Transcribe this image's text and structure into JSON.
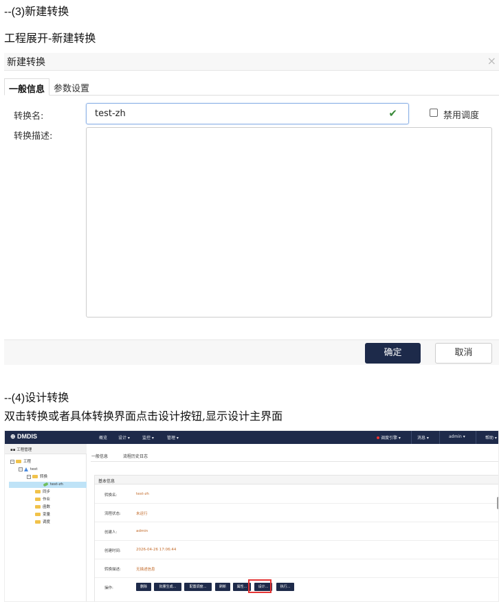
{
  "step3": {
    "num": "--(3)",
    "title": "新建转换"
  },
  "step3_sub": "工程展开-新建转换",
  "dialog": {
    "title": "新建转换",
    "close": "×",
    "tabs": [
      {
        "label": "一般信息"
      },
      {
        "label": "参数设置"
      }
    ],
    "name_label": "转换名:",
    "name_value": "test-zh",
    "valid_mark": "✔",
    "disable_schedule_label": "禁用调度",
    "disable_schedule_checked": false,
    "desc_label": "转换描述:",
    "desc_value": "",
    "confirm": "确定",
    "cancel": "取消"
  },
  "step4": {
    "num": "--(4)",
    "title": "设计转换"
  },
  "step4_sub": "双击转换或者具体转换界面点击设计按钮,显示设计主界面",
  "app": {
    "logo": "⊕ DMDIS",
    "nav": [
      "概览",
      "设计 ▾",
      "监控 ▾",
      "管理 ▾"
    ],
    "engine": "调度引擎 ▾",
    "messages": "消息 ▾",
    "user": "admin ▾",
    "help": "帮助 ▾",
    "sidebar_title": "工程管理",
    "tree": [
      "工程",
      "test",
      "转换",
      "test-zh",
      "同步",
      "作业",
      "函数",
      "变量",
      "调度"
    ],
    "tabs": [
      "一般信息",
      "流程历史日志"
    ],
    "card_title": "基本信息",
    "rows": [
      {
        "k": "转换名:",
        "v": "test-zh"
      },
      {
        "k": "流程状态:",
        "v": "未运行"
      },
      {
        "k": "创建人:",
        "v": "admin"
      },
      {
        "k": "创建时间:",
        "v": "2026-04-26 17:06:44"
      },
      {
        "k": "转换描述:",
        "v": "无描述信息"
      }
    ],
    "actions_label": "操作:",
    "actions": [
      "删除",
      "批量生成...",
      "配置调度...",
      "刷新",
      "属性...",
      "设计...",
      "执行..."
    ],
    "accent": "#1e2a4a",
    "highlight": "#e53333"
  }
}
